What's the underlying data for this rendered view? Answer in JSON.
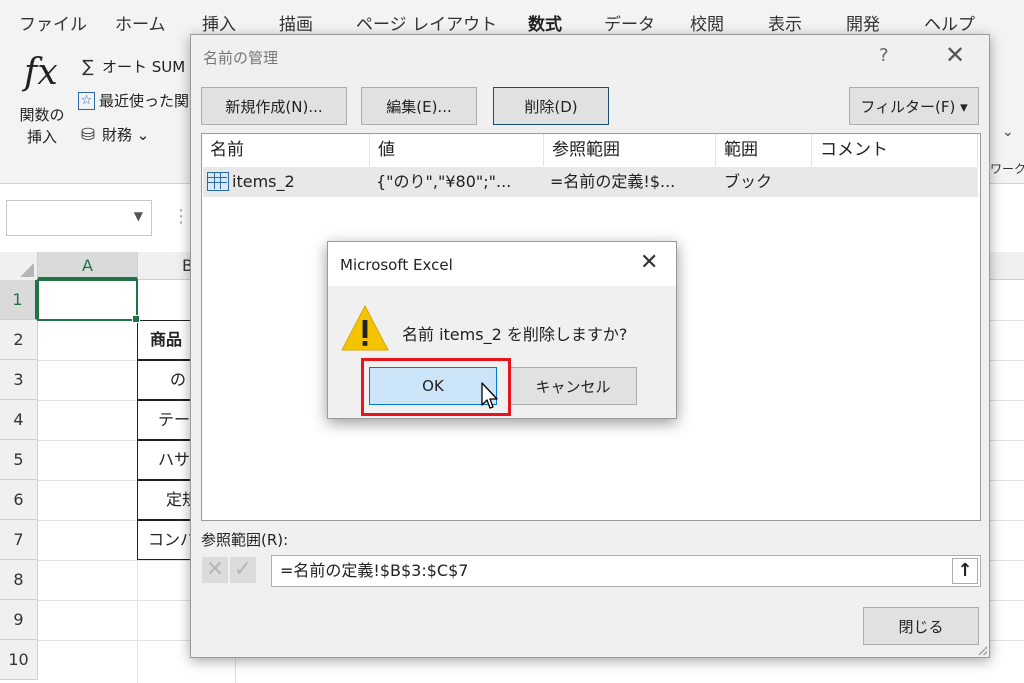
{
  "ribbon": {
    "tabs": [
      {
        "label": "ファイル",
        "active": false
      },
      {
        "label": "ホーム",
        "active": false
      },
      {
        "label": "挿入",
        "active": false
      },
      {
        "label": "描画",
        "active": false
      },
      {
        "label": "ページ レイアウト",
        "active": false
      },
      {
        "label": "数式",
        "active": true
      },
      {
        "label": "データ",
        "active": false
      },
      {
        "label": "校閲",
        "active": false
      },
      {
        "label": "表示",
        "active": false
      },
      {
        "label": "開発",
        "active": false
      },
      {
        "label": "ヘルプ",
        "active": false
      }
    ],
    "insert_function": {
      "glyph": "fx",
      "label_line1": "関数の",
      "label_line2": "挿入"
    },
    "function_items": [
      {
        "icon": "sigma-icon",
        "glyph": "∑",
        "label": "オート SUM"
      },
      {
        "icon": "star-icon",
        "glyph": "☆",
        "label": "最近使った関"
      },
      {
        "icon": "database-icon",
        "glyph": "⛁",
        "label": "財務 ⌄"
      }
    ],
    "right_group_label": "ワークシ"
  },
  "sheet": {
    "columns": [
      "A",
      "B"
    ],
    "rows": [
      "1",
      "2",
      "3",
      "4",
      "5",
      "6",
      "7",
      "8",
      "9",
      "10"
    ],
    "cells": [
      {
        "row": 2,
        "text": "商品"
      },
      {
        "row": 3,
        "text": "の"
      },
      {
        "row": 4,
        "text": "テー"
      },
      {
        "row": 5,
        "text": "ハサ"
      },
      {
        "row": 6,
        "text": "定規"
      },
      {
        "row": 7,
        "text": "コンパ"
      }
    ]
  },
  "name_manager": {
    "title": "名前の管理",
    "help_glyph": "?",
    "close_glyph": "✕",
    "buttons": {
      "new": "新規作成(N)...",
      "edit": "編集(E)...",
      "delete": "削除(D)",
      "filter": "フィルター(F) ▾"
    },
    "columns": [
      "名前",
      "値",
      "参照範囲",
      "範囲",
      "コメント"
    ],
    "rows": [
      {
        "name": "items_2",
        "value": "{\"のり\",\"¥80\";\"...",
        "refers_to": "=名前の定義!$...",
        "scope": "ブック",
        "comment": ""
      }
    ],
    "ref_label": "参照範囲(R):",
    "ref_value": "=名前の定義!$B$3:$C$7",
    "close_button": "閉じる"
  },
  "message_box": {
    "title": "Microsoft Excel",
    "close_glyph": "✕",
    "message": "名前 items_2 を削除しますか?",
    "ok": "OK",
    "cancel": "キャンセル"
  },
  "colors": {
    "accent": "#217346",
    "highlight": "#e8141c",
    "focus_button": "#cce4f7",
    "warning": "#f5c400"
  }
}
